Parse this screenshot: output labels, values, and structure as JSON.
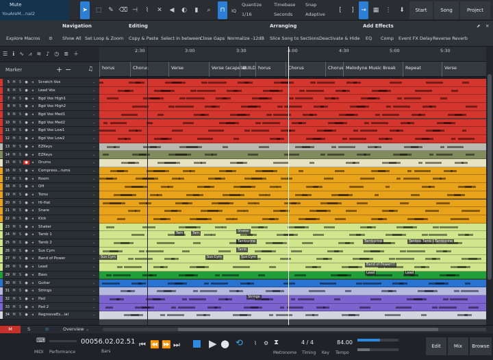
{
  "song": {
    "mute_label": "Mute",
    "file_name": "YouAreM...nal2"
  },
  "toolbar": {
    "quantize_label": "Quantize",
    "quantize_value": "1/16",
    "timebase_label": "Timebase",
    "timebase_value": "Seconds",
    "snap_label": "Snap",
    "snap_value": "Adaptive",
    "iq_label": "IQ",
    "start_label": "Start",
    "song_label": "Song",
    "project_label": "Project",
    "accent": "#2c7fd6"
  },
  "macros": {
    "navigation_title": "Navigation",
    "navigation_items": [
      "Explore Macros",
      "Show All",
      "Set Loop & Zoom"
    ],
    "editing_title": "Editing",
    "editing_items": [
      "Copy & Paste",
      "Select in between",
      "Close Gaps",
      "Normalize -12dB"
    ],
    "arranging_title": "Arranging",
    "arranging_items": [
      "Slice Song to Sections",
      "Deactivate & Hide"
    ],
    "effects_title": "Add Effects",
    "effects_items": [
      "EQ",
      "Comp",
      "Event FX Delay",
      "Reverse Reverb"
    ]
  },
  "marker_label": "Marker",
  "ruler": [
    "2:30",
    "3:00",
    "3:30",
    "4:00",
    "4:30",
    "5:00",
    "5:30"
  ],
  "sections": [
    "horus",
    "Chorus",
    "Verse",
    "Verse (acapela)",
    "BUILD",
    "horus",
    "Chorus",
    "Chorus",
    "Melodyne Music Break",
    "Repeat",
    "Verse"
  ],
  "tracks": [
    {
      "num": "5",
      "name": "Scratch Vox",
      "color": "#d4352c"
    },
    {
      "num": "6",
      "name": "Lead Vox",
      "color": "#d4352c"
    },
    {
      "num": "7",
      "name": "Bgd Vox High1",
      "color": "#d4352c"
    },
    {
      "num": "8",
      "name": "Bgd Vox High2",
      "color": "#d4352c"
    },
    {
      "num": "9",
      "name": "Bgd Vox Med1",
      "color": "#d4352c"
    },
    {
      "num": "10",
      "name": "Bgd Vox Med2",
      "color": "#d4352c"
    },
    {
      "num": "11",
      "name": "Bgd Vox Low1",
      "color": "#d4352c"
    },
    {
      "num": "12",
      "name": "Bgd Vox Low2",
      "color": "#d4352c"
    },
    {
      "num": "13",
      "name": "EZKeys",
      "color": "#b9b9b0"
    },
    {
      "num": "14",
      "name": "EZKeys",
      "color": "#828b5c"
    },
    {
      "num": "15",
      "name": "Drums",
      "color": "#e7e3c2"
    },
    {
      "num": "16",
      "name": "Compress...rums",
      "color": "#e9a318"
    },
    {
      "num": "17",
      "name": "Room",
      "color": "#e9a318"
    },
    {
      "num": "18",
      "name": "OH",
      "color": "#e9a318"
    },
    {
      "num": "19",
      "name": "Toms",
      "color": "#e9a318"
    },
    {
      "num": "20",
      "name": "Hi-Hat",
      "color": "#e9a318"
    },
    {
      "num": "21",
      "name": "Snare",
      "color": "#e9a318"
    },
    {
      "num": "22",
      "name": "Kick",
      "color": "#e9a318"
    },
    {
      "num": "23",
      "name": "Shaker",
      "color": "#cfe68d"
    },
    {
      "num": "24",
      "name": "Tamb 1",
      "color": "#cfe68d"
    },
    {
      "num": "25",
      "name": "Tamb 2",
      "color": "#cfe68d"
    },
    {
      "num": "26",
      "name": "Sus Cym",
      "color": "#cfe68d"
    },
    {
      "num": "27",
      "name": "Band of Power",
      "color": "#cfe68d"
    },
    {
      "num": "28",
      "name": "Lead",
      "color": "#cfe68d"
    },
    {
      "num": "29",
      "name": "Bass",
      "color": "#1f9e3a"
    },
    {
      "num": "30",
      "name": "Guitar",
      "color": "#2872d0"
    },
    {
      "num": "31",
      "name": "Strings",
      "color": "#b5b8df"
    },
    {
      "num": "32",
      "name": "Pad",
      "color": "#7c64d0"
    },
    {
      "num": "33",
      "name": "Pad 2",
      "color": "#7c64d0"
    },
    {
      "num": "34",
      "name": "RegrooveEs...ial",
      "color": "#d2d4de"
    }
  ],
  "clip_labels": [
    "Shaker",
    "Tam",
    "Tam",
    "Tambo",
    "Tamborine",
    "Tamborine",
    "Tambour",
    "Tamb",
    "Tamborine",
    "Tamb",
    "Sus Cym",
    "Sus Cym",
    "Sus Cym",
    "Band of Power!!!",
    "Lead",
    "Lead",
    "Strings"
  ],
  "bottom": {
    "m_label": "M",
    "s_label": "S",
    "overview_label": "Overview"
  },
  "transport": {
    "midi_label": "MIDI",
    "performance_label": "Performance",
    "time": "00056.02.02.51",
    "time_label": "Bars",
    "metronome_label": "Metronome",
    "timing_value": "4 / 4",
    "timing_label": "Timing",
    "key_label": "Key",
    "tempo_value": "84.00",
    "tempo_label": "Tempo",
    "edit_label": "Edit",
    "mix_label": "Mix",
    "browse_label": "Browse"
  }
}
